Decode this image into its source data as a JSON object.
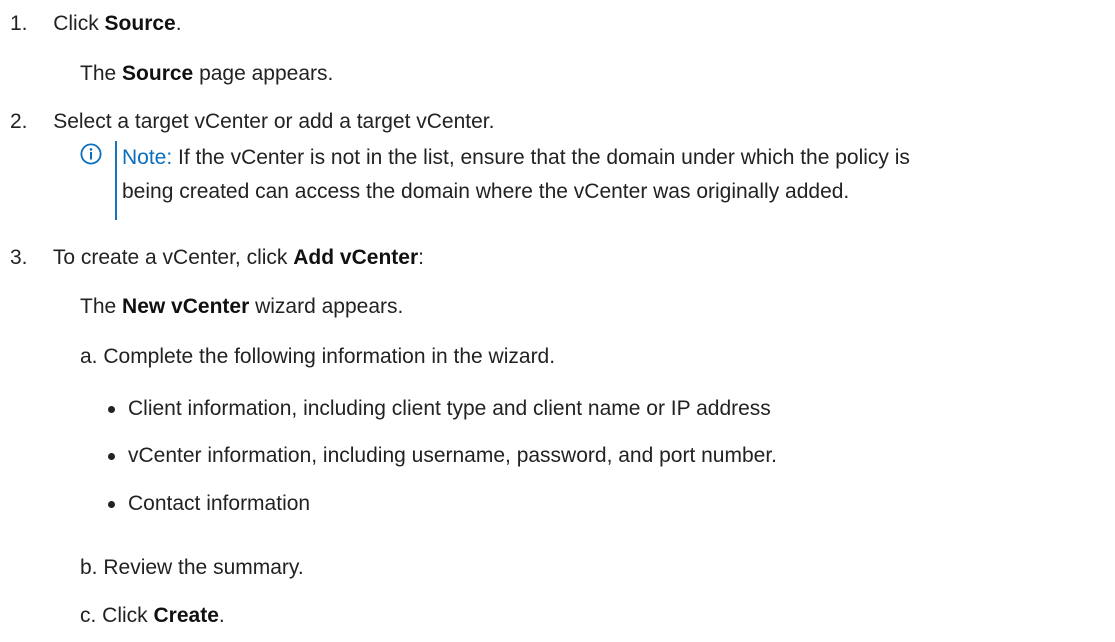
{
  "steps": [
    {
      "number": "1.",
      "pre": "Click ",
      "bold": "Source",
      "post": ".",
      "result_pre": "The ",
      "result_bold": "Source",
      "result_post": " page appears."
    },
    {
      "number": "2.",
      "text": "Select a target vCenter or add a target vCenter.",
      "note": {
        "label": "Note:",
        "line1": " If the vCenter is not in the list, ensure that the domain under which the policy is",
        "line2": "being created can access the domain where the vCenter was originally added."
      }
    },
    {
      "number": "3.",
      "pre": "To create a vCenter, click ",
      "bold": "Add vCenter",
      "post": ":",
      "result_pre": "The ",
      "result_bold": "New vCenter",
      "result_post": " wizard appears.",
      "substeps": {
        "a": {
          "text": "a. Complete the following information in the wizard.",
          "bullets": [
            "Client information, including client type and client name or IP address",
            "vCenter information, including username, password, and port number.",
            "Contact information"
          ]
        },
        "b": {
          "text": "b. Review the summary."
        },
        "c": {
          "pre": "c. Click ",
          "bold": "Create",
          "post": "."
        }
      }
    }
  ],
  "icons": {
    "info": "info-circle-icon"
  },
  "colors": {
    "note_accent": "#0a6ebd",
    "text": "#222222"
  }
}
